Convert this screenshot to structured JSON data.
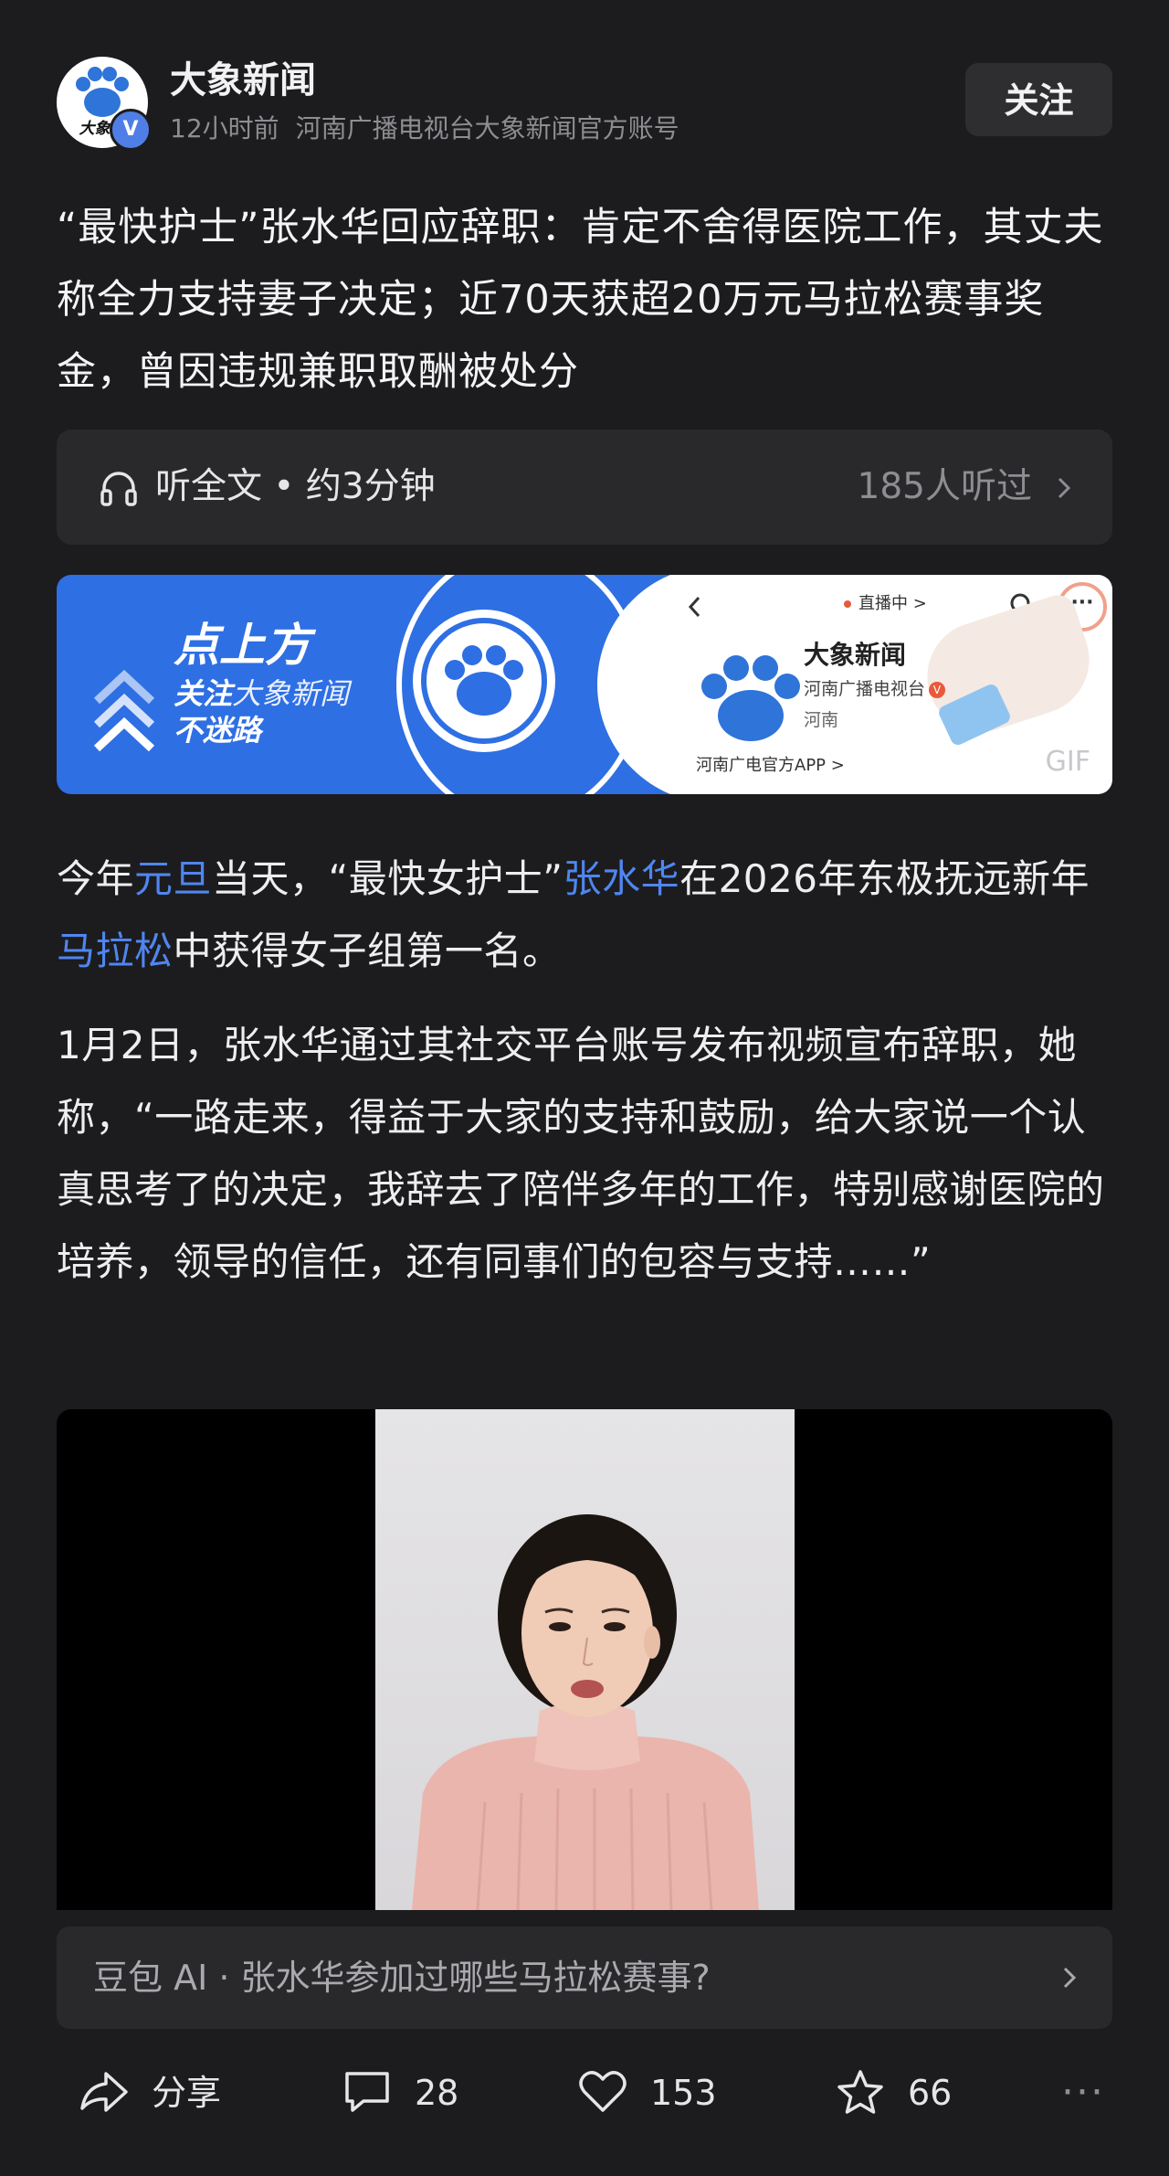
{
  "header": {
    "account_name": "大象新闻",
    "time_ago": "12小时前",
    "account_desc": "河南广播电视台大象新闻官方账号",
    "avatar_text": "大象新",
    "verified_mark": "V",
    "follow_label": "关注"
  },
  "article": {
    "title": "“最快护士”张水华回应辞职：肯定不舍得医院工作，其丈夫称全力支持妻子决定；近70天获超20万元马拉松赛事奖金，曾因违规兼职取酬被处分"
  },
  "listen": {
    "label": "听全文 • 约3分钟",
    "count": "185人听过"
  },
  "banner": {
    "line1": "点上方",
    "line2_bold": "关注",
    "line2_light": "大象新闻",
    "line3": "不迷路",
    "mini_live": "直播中 >",
    "mini_name": "大象新闻",
    "mini_sub": "河南广播电视台",
    "mini_v": "V",
    "mini_region": "河南",
    "mini_app": "河南广电官方APP >",
    "mini_more": "···",
    "gif_label": "GIF"
  },
  "paragraph1": {
    "t1": "今年",
    "link1": "元旦",
    "t2": "当天，“最快女护士”",
    "link2": "张水华",
    "t3": "在2026年东极抚远新年",
    "link3": "马拉松",
    "t4": "中获得女子组第一名。"
  },
  "paragraph2": {
    "text": "1月2日，张水华通过其社交平台账号发布视频宣布辞职，她称，“一路走来，得益于大家的支持和鼓励，给大家说一个认真思考了的决定，我辞去了陪伴多年的工作，特别感谢医院的培养，领导的信任，还有同事们的包容与支持……”"
  },
  "ai_bar": {
    "text": "豆包 AI · 张水华参加过哪些马拉松赛事?"
  },
  "actions": {
    "share_label": "分享",
    "comments": "28",
    "likes": "153",
    "favorites": "66",
    "more": "···"
  },
  "colors": {
    "background": "#1c1c1e",
    "link": "#4f86f0",
    "banner_blue": "#2e6fe3",
    "card": "#29292c"
  }
}
